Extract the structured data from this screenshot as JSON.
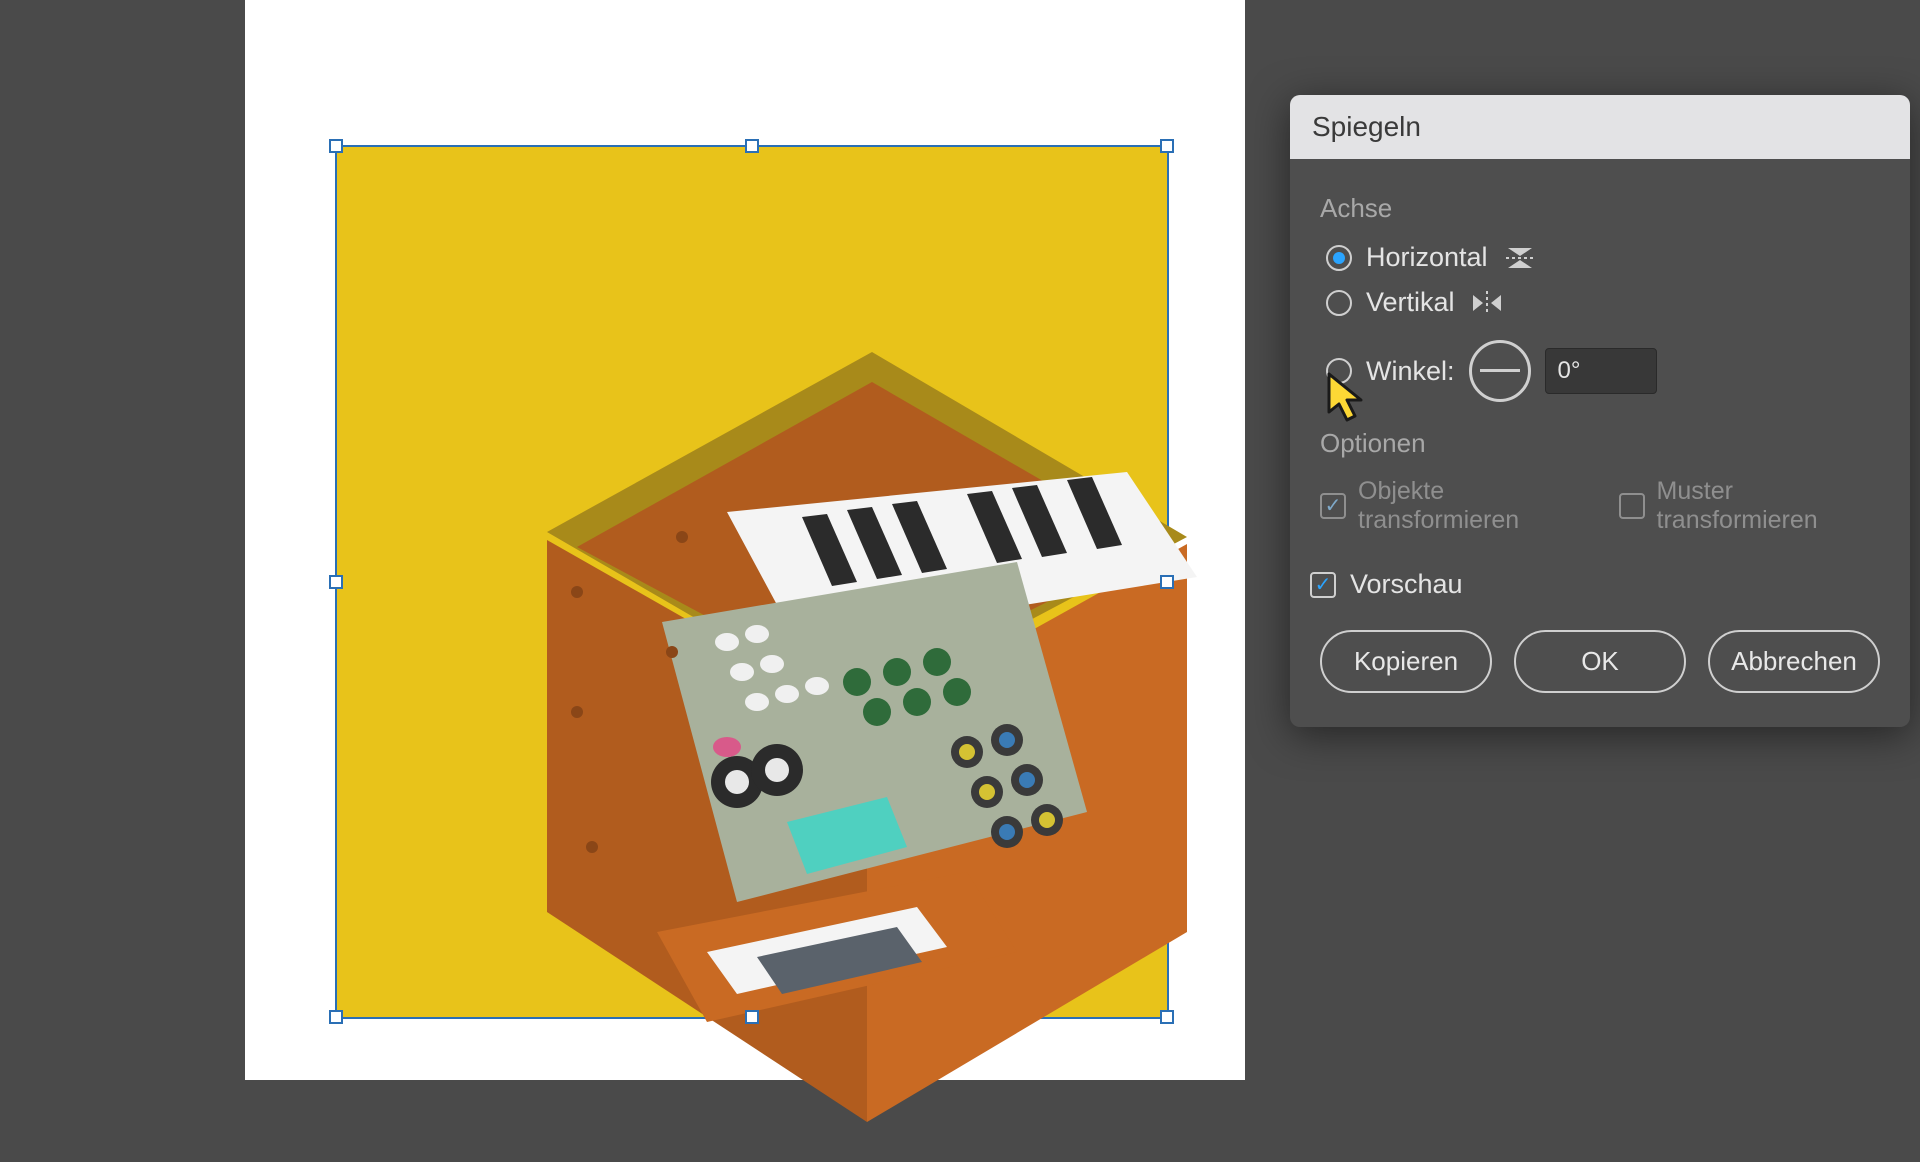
{
  "dialog": {
    "title": "Spiegeln",
    "axis_label": "Achse",
    "horizontal_label": "Horizontal",
    "vertical_label": "Vertikal",
    "angle_label": "Winkel:",
    "angle_value": "0°",
    "options_label": "Optionen",
    "transform_objects_label": "Objekte transformieren",
    "transform_patterns_label": "Muster transformieren",
    "preview_label": "Vorschau",
    "copy_label": "Kopieren",
    "ok_label": "OK",
    "cancel_label": "Abbrechen",
    "axis_selected": "horizontal",
    "transform_objects_checked": true,
    "transform_patterns_checked": false,
    "preview_checked": true
  },
  "artwork": {
    "description": "Isometric illustration of a brown wooden synthesizer / keyboard case on a yellow square background, selected with blue bounding box",
    "bg_color": "#e8c31a",
    "selection_color": "#2a6fb5"
  }
}
